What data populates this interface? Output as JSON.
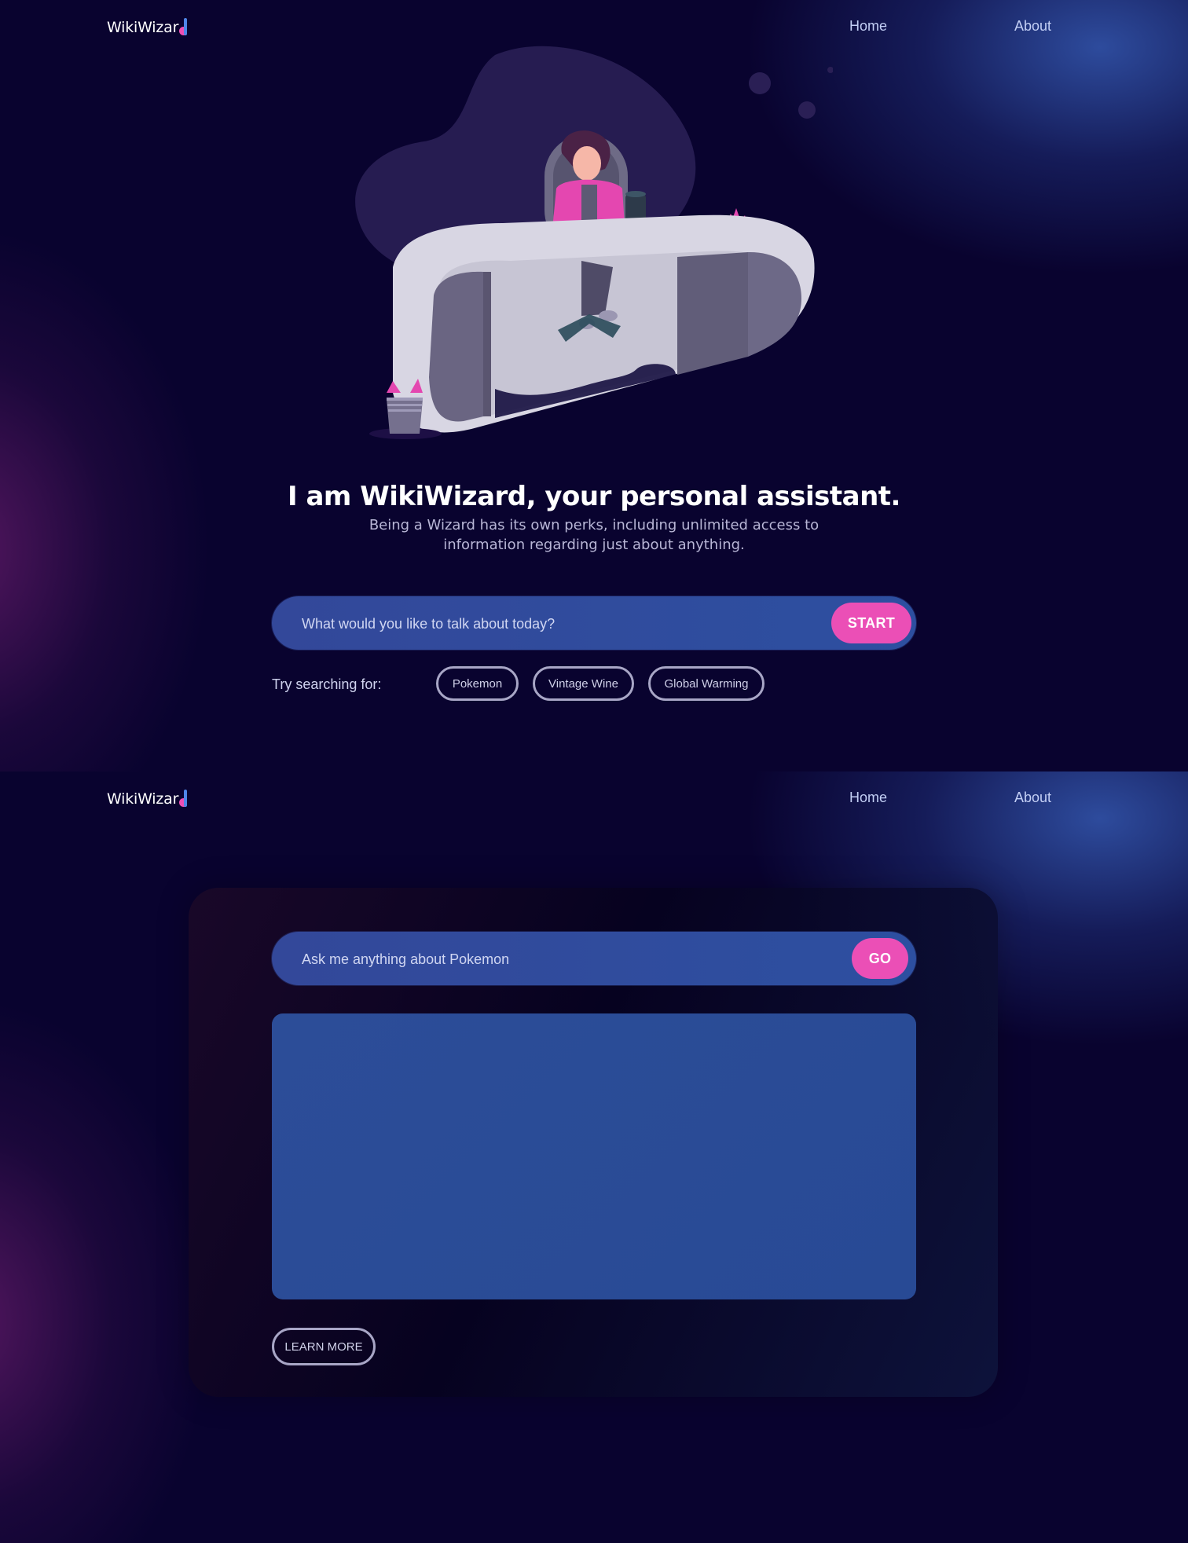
{
  "brand": {
    "logo_text": "WikiWizar"
  },
  "nav": {
    "home_label": "Home",
    "about_label": "About"
  },
  "hero": {
    "title": "I am WikiWizard, your personal assistant.",
    "subtitle": "Being a Wizard has its own perks, including unlimited access to information regarding just about anything."
  },
  "search": {
    "placeholder": "What would you like to talk about today?",
    "button_label": "START"
  },
  "suggestions": {
    "label": "Try searching for:",
    "items": [
      "Pokemon",
      "Vintage Wine",
      "Global Warming"
    ]
  },
  "chat": {
    "placeholder": "Ask me anything about Pokemon",
    "button_label": "GO",
    "answer_text": "",
    "learn_more_label": "LEARN MORE"
  },
  "colors": {
    "background": "#09032f",
    "accent_pink": "#eb4fb6",
    "accent_blue": "#2d4fa0",
    "logo_blue": "#4f86e8"
  },
  "icons": [
    "logo-d-mark-icon",
    "desk-illustration",
    "plant-pot-icon"
  ]
}
